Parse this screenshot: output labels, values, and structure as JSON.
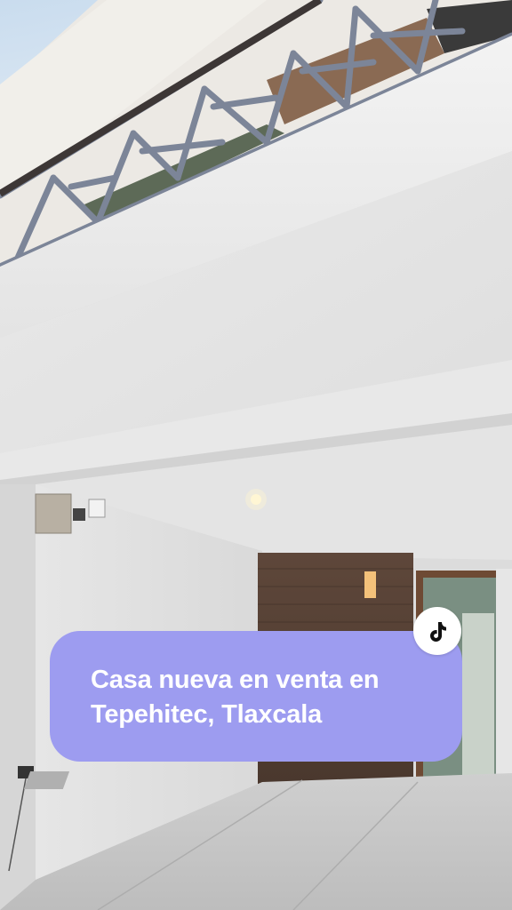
{
  "caption": {
    "text": "Casa nueva en venta en\nTepehitec, Tlaxcala",
    "background": "#9d9cf0",
    "text_color": "#ffffff"
  },
  "badge": {
    "icon": "tiktok-icon",
    "background": "#ffffff"
  },
  "photo": {
    "subject": "house-facade-photo"
  }
}
